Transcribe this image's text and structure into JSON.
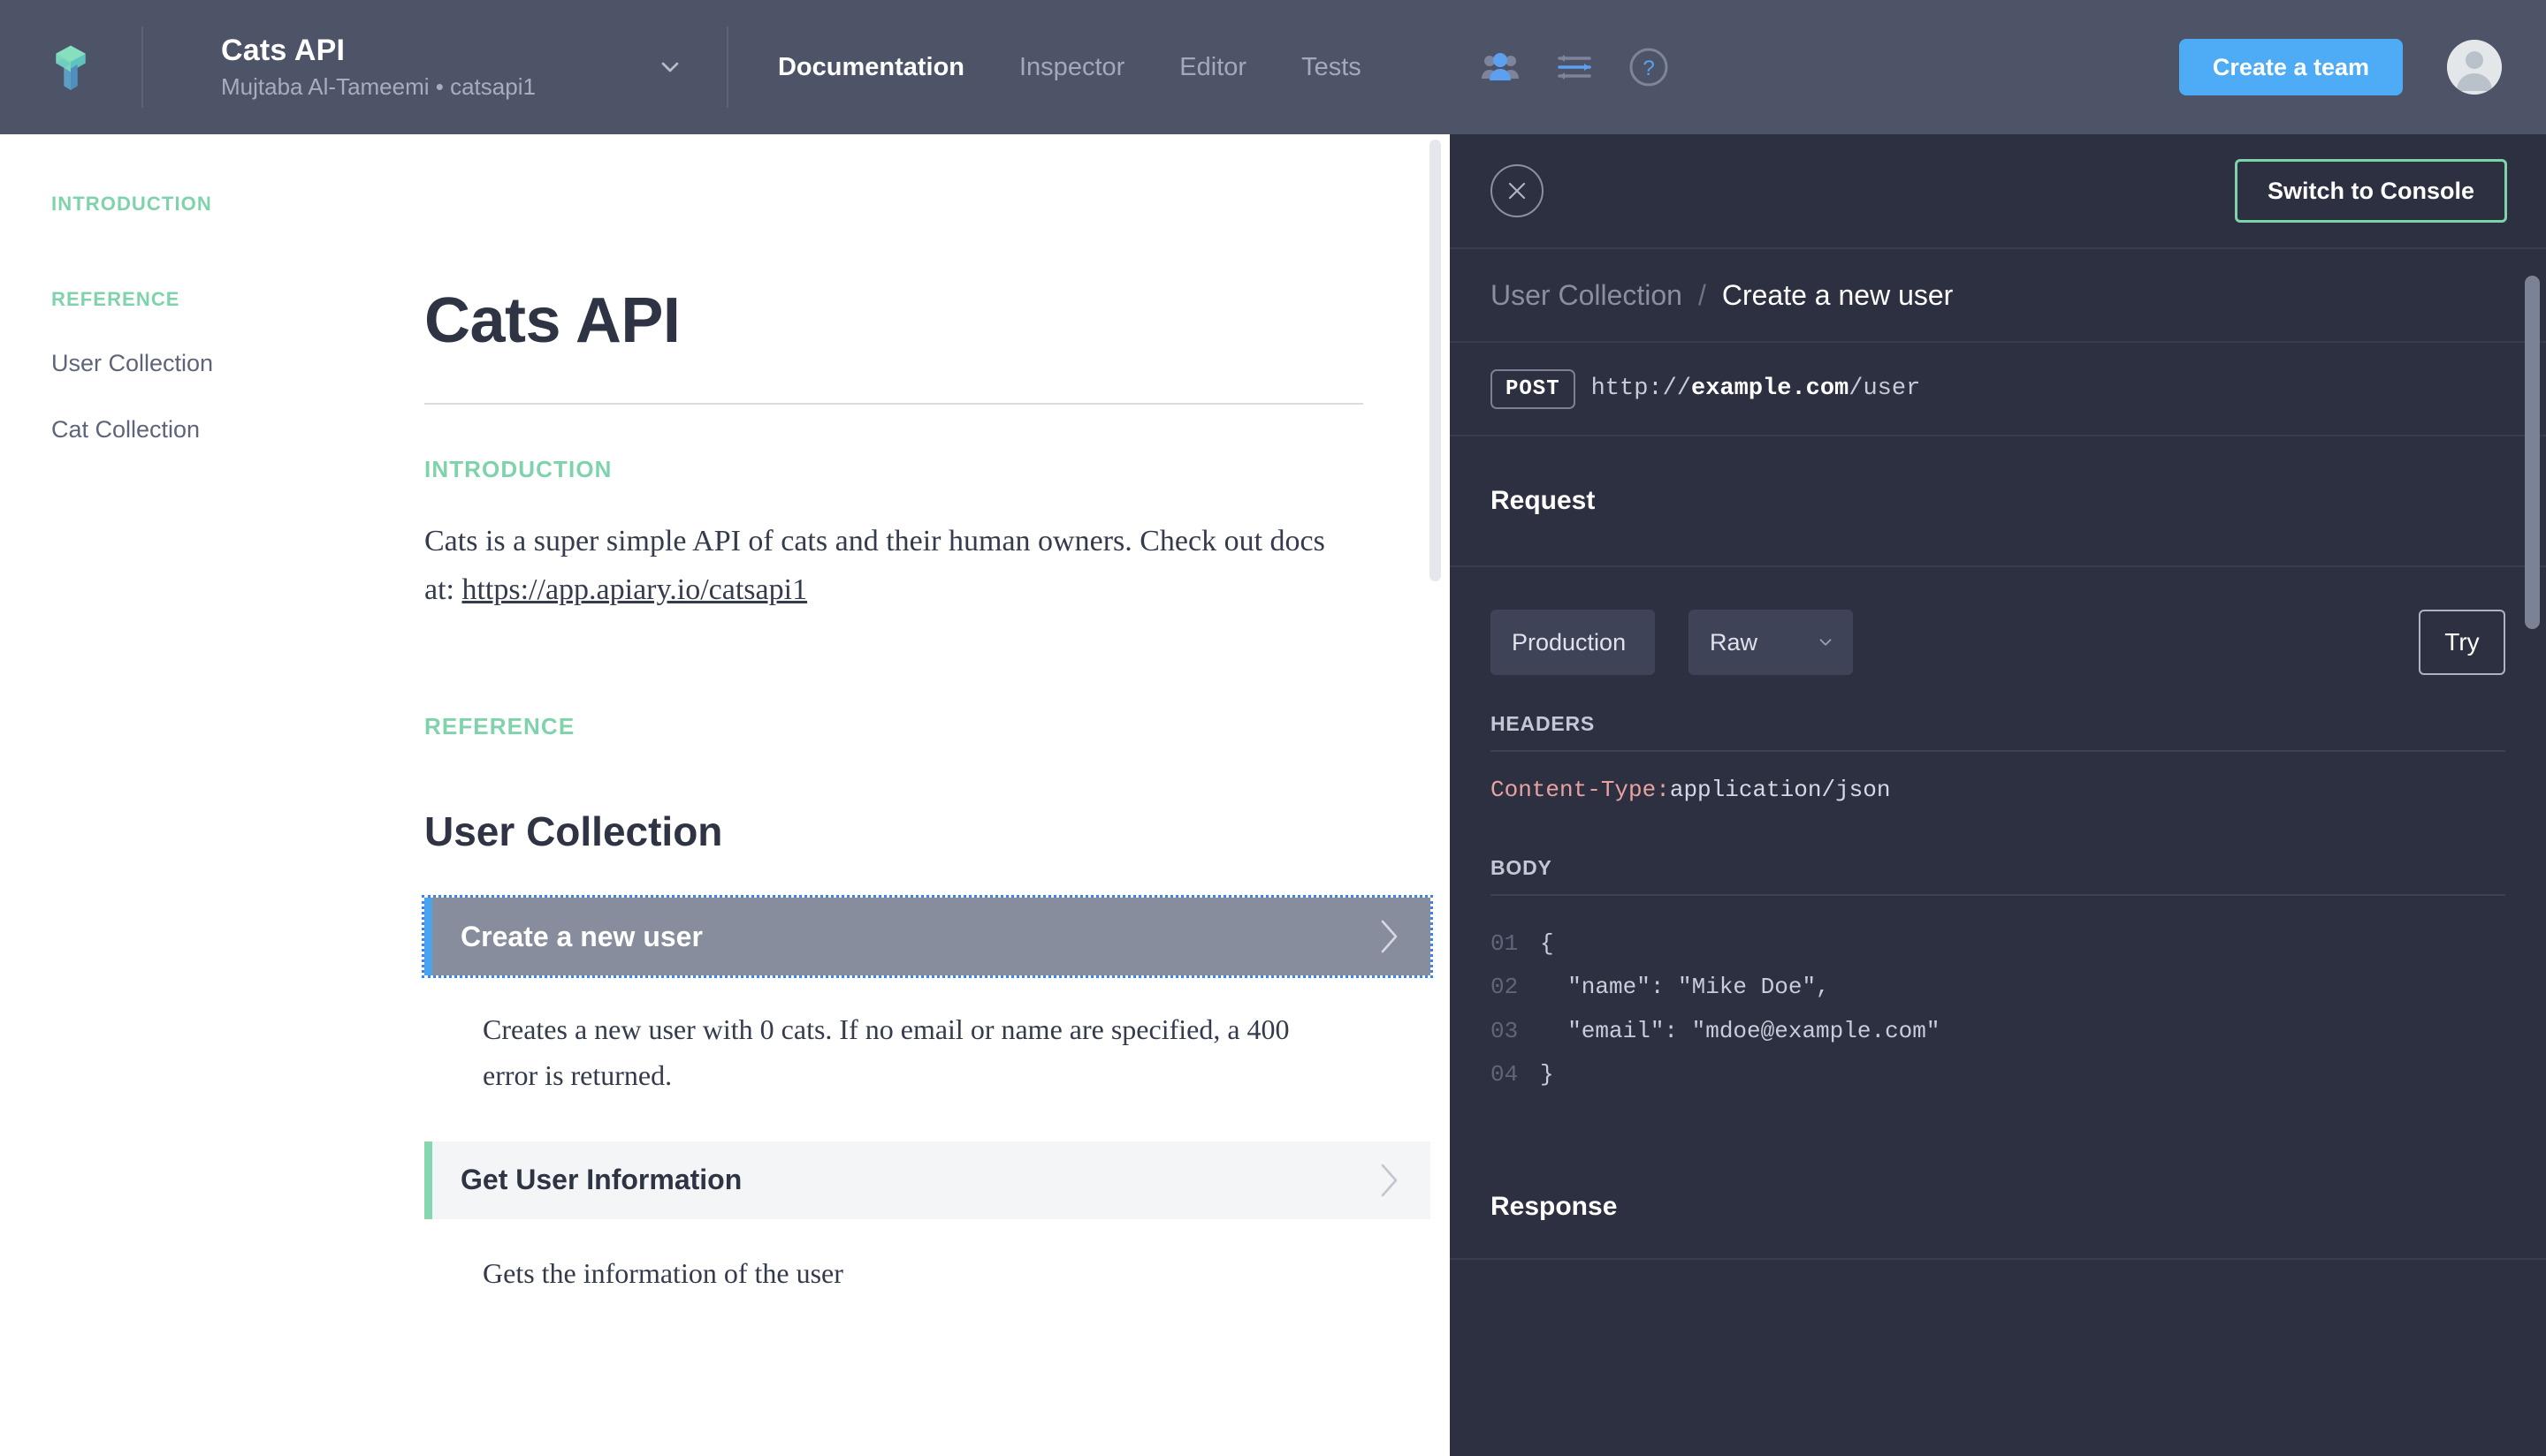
{
  "topbar": {
    "logo_icon": "apiary-cube-logo",
    "project_title": "Cats API",
    "project_subtitle": "Mujtaba Al-Tameemi • catsapi1",
    "project_chevron_icon": "chevron-down-icon",
    "tabs": [
      {
        "label": "Documentation",
        "active": true
      },
      {
        "label": "Inspector",
        "active": false
      },
      {
        "label": "Editor",
        "active": false
      },
      {
        "label": "Tests",
        "active": false
      }
    ],
    "icons": [
      {
        "name": "people-icon"
      },
      {
        "name": "sliders-icon"
      },
      {
        "name": "help-circle-icon"
      }
    ],
    "create_team_label": "Create a team",
    "avatar_icon": "user-avatar",
    "accent_blue": "#4eabf5",
    "background": "#4e5468"
  },
  "sidebar": {
    "sections": [
      {
        "title": "INTRODUCTION",
        "items": []
      },
      {
        "title": "REFERENCE",
        "items": [
          {
            "label": "User Collection"
          },
          {
            "label": "Cat Collection"
          }
        ]
      }
    ],
    "accent_green": "#7fd3ab"
  },
  "document": {
    "title": "Cats API",
    "intro_kicker": "INTRODUCTION",
    "intro_text_before": "Cats is a super simple API of cats and their human owners. Check out docs at: ",
    "intro_link": "https://app.apiary.io/catsapi1",
    "reference_kicker": "REFERENCE",
    "section_title": "User Collection",
    "actions": [
      {
        "label": "Create a new user",
        "selected": true,
        "chevron_icon": "chevron-right-icon",
        "description": "Creates a new user with 0 cats. If no email or name are specified, a 400 error is returned."
      },
      {
        "label": "Get User Information",
        "selected": false,
        "chevron_icon": "chevron-right-icon",
        "description": "Gets the information of the user"
      }
    ]
  },
  "console": {
    "close_icon": "close-circle-icon",
    "switch_label": "Switch to Console",
    "accent_green": "#7fd3ab",
    "background": "#2c3040",
    "breadcrumb": {
      "parent": "User Collection",
      "separator": "/",
      "current": "Create a new user"
    },
    "endpoint": {
      "method": "POST",
      "url_prefix": "http://",
      "url_host": "example.com",
      "url_path": "/user"
    },
    "request": {
      "heading": "Request",
      "environment_select": {
        "value": "Production",
        "chevron_icon": "chevron-down-icon"
      },
      "format_select": {
        "value": "Raw",
        "chevron_icon": "chevron-down-icon"
      },
      "try_label": "Try",
      "headers_label": "HEADERS",
      "header_key": "Content-Type",
      "header_colon": ":",
      "header_value": "application/json",
      "body_label": "BODY",
      "body_lines": [
        {
          "num": "01",
          "code": "{"
        },
        {
          "num": "02",
          "code": "  \"name\": \"Mike Doe\","
        },
        {
          "num": "03",
          "code": "  \"email\": \"mdoe@example.com\""
        },
        {
          "num": "04",
          "code": "}"
        }
      ]
    },
    "response": {
      "heading": "Response"
    }
  }
}
